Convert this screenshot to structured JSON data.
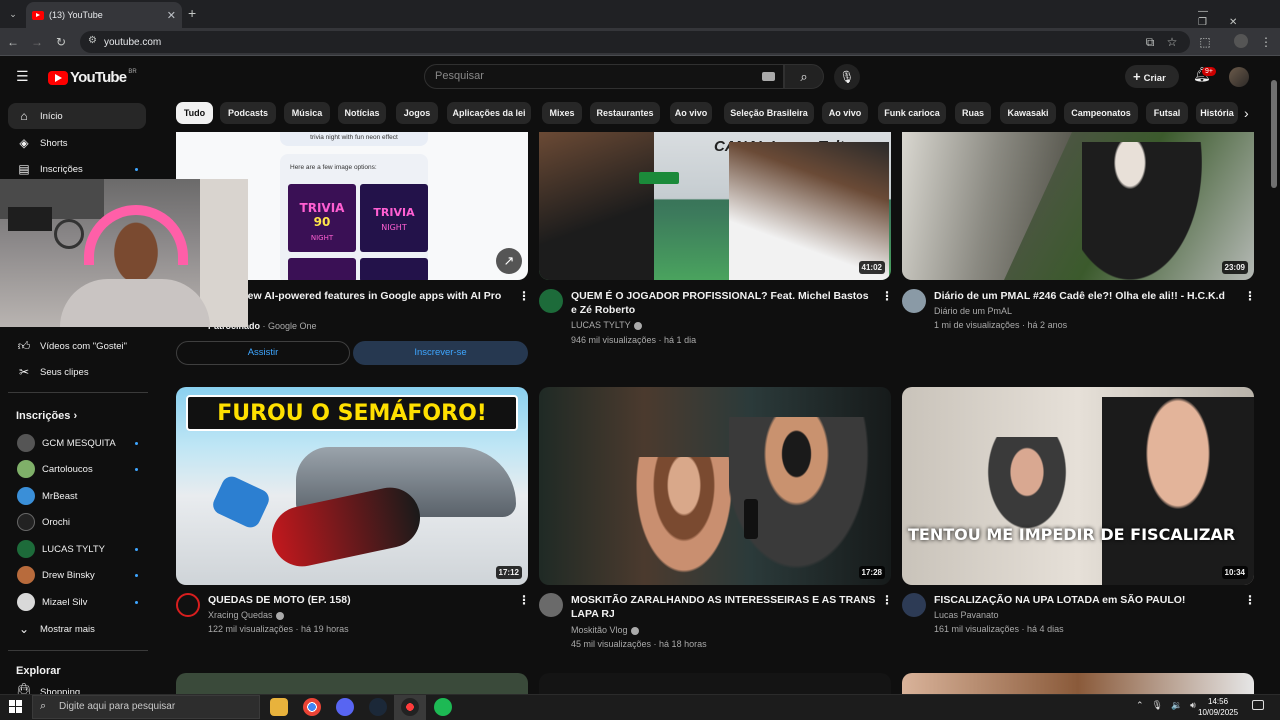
{
  "browser": {
    "tab_title": "(13) YouTube",
    "url": "youtube.com"
  },
  "header": {
    "logo_text": "YouTube",
    "region": "BR",
    "search_placeholder": "Pesquisar",
    "create_label": "Criar",
    "notifications_badge": "9+"
  },
  "sidebar": {
    "main": [
      {
        "label": "Início",
        "icon": "home-icon"
      },
      {
        "label": "Shorts",
        "icon": "shorts-icon"
      },
      {
        "label": "Inscrições",
        "icon": "subscriptions-icon"
      }
    ],
    "you": [
      {
        "label": "Vídeos com \"Gostei\"",
        "icon": "like-icon"
      },
      {
        "label": "Seus clipes",
        "icon": "scissors-icon"
      }
    ],
    "subs_title": "Inscrições",
    "subscriptions": [
      {
        "label": "GCM MESQUITA",
        "new": true
      },
      {
        "label": "Cartoloucos",
        "new": true
      },
      {
        "label": "MrBeast",
        "new": false
      },
      {
        "label": "Orochi",
        "new": false
      },
      {
        "label": "LUCAS TYLTY",
        "new": true
      },
      {
        "label": "Drew Binsky",
        "new": true
      },
      {
        "label": "Mizael Silv",
        "new": true
      }
    ],
    "show_more": "Mostrar mais",
    "explore_title": "Explorar",
    "explore_first": "Shopping"
  },
  "chips": [
    "Tudo",
    "Podcasts",
    "Música",
    "Notícias",
    "Jogos",
    "Aplicações da lei",
    "Mixes",
    "Restaurantes",
    "Ao vivo",
    "Seleção Brasileira",
    "Ao vivo",
    "Funk carioca",
    "Ruas",
    "Kawasaki",
    "Campeonatos",
    "Futsal",
    "História"
  ],
  "ad": {
    "mock_caption": "trivia night with fun neon effect",
    "mock_prompt": "Here are a few image options:",
    "title": "ess to new AI-powered features in Google apps with AI Pro",
    "sponsor_label": "Patrocinado",
    "advertiser": "Google One",
    "watch_label": "Assistir",
    "subscribe_label": "Inscrever-se"
  },
  "videos": [
    {
      "title": "QUEM É O JOGADOR PROFISSIONAL? Feat. Michel Bastos e Zé Roberto",
      "channel": "LUCAS TYLTY",
      "verified": true,
      "views": "946 mil visualizações",
      "age": "há 1 dia",
      "duration": "41:02",
      "thumb_text": "CANAL Lucas Tylty"
    },
    {
      "title": "Diário de um PMAL #246 Cadê ele?! Olha ele ali!! - H.C.K.d",
      "channel": "Diário de um PmAL",
      "verified": false,
      "views": "1 mi de visualizações",
      "age": "há 2 anos",
      "duration": "23:09",
      "thumb_text": ""
    },
    {
      "title": "QUEDAS DE MOTO (EP. 158)",
      "channel": "Xracing Quedas",
      "verified": true,
      "views": "122 mil visualizações",
      "age": "há 19 horas",
      "duration": "17:12",
      "thumb_text": "FUROU O SEMÁFORO!"
    },
    {
      "title": "MOSKITÃO ZARALHANDO AS INTERESSEIRAS E AS TRANS LAPA RJ",
      "channel": "Moskitão Vlog",
      "verified": true,
      "views": "45 mil visualizações",
      "age": "há 18 horas",
      "duration": "17:28",
      "thumb_text": ""
    },
    {
      "title": "FISCALIZAÇÃO NA UPA LOTADA em SÃO PAULO!",
      "channel": "Lucas Pavanato",
      "verified": false,
      "views": "161 mil visualizações",
      "age": "há 4 dias",
      "duration": "10:34",
      "thumb_text": "TENTOU ME IMPEDIR DE FISCALIZAR"
    }
  ],
  "taskbar": {
    "search_placeholder": "Digite aqui para pesquisar",
    "time": "14:56",
    "date": "10/09/2025"
  }
}
